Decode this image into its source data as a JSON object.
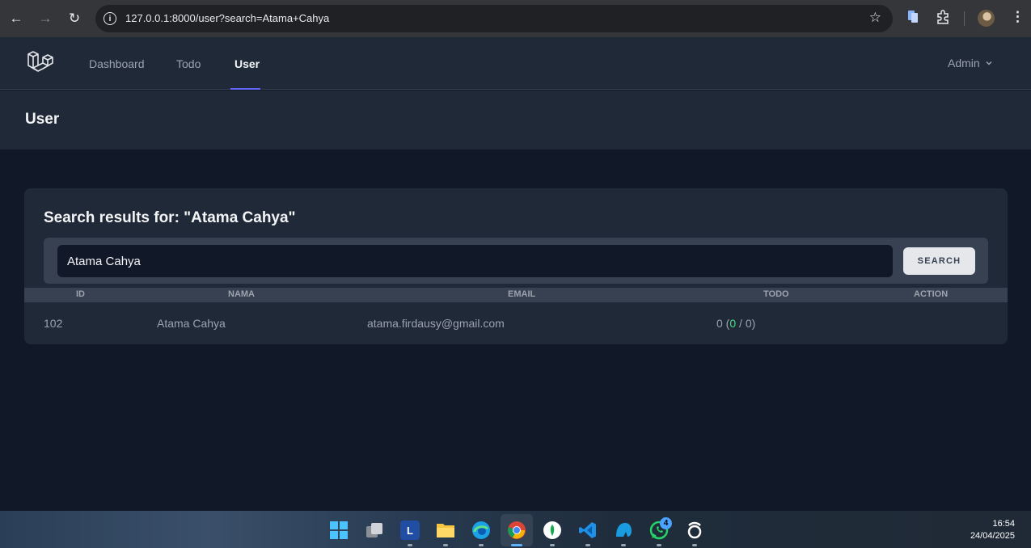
{
  "browser": {
    "url": "127.0.0.1:8000/user?search=Atama+Cahya"
  },
  "nav": {
    "links": [
      {
        "label": "Dashboard"
      },
      {
        "label": "Todo"
      },
      {
        "label": "User"
      }
    ],
    "active": "User",
    "user_menu": "Admin"
  },
  "page": {
    "title": "User"
  },
  "search": {
    "heading": "Search results for: \"Atama Cahya\"",
    "value": "Atama Cahya",
    "button_label": "SEARCH"
  },
  "table": {
    "headers": [
      "ID",
      "NAMA",
      "EMAIL",
      "TODO",
      "ACTION"
    ],
    "rows": [
      {
        "id": "102",
        "nama": "Atama Cahya",
        "email": "atama.firdausy@gmail.com",
        "todo_total": "0",
        "todo_done": "0",
        "todo_pending": "0"
      }
    ]
  },
  "taskbar": {
    "apps": [
      "start-icon",
      "task-view-icon",
      "l-app-icon",
      "file-explorer-icon",
      "edge-icon",
      "chrome-icon",
      "mongodb-compass-icon",
      "vscode-icon",
      "mysql-workbench-icon",
      "whatsapp-icon",
      "threads-icon"
    ],
    "whatsapp_badge": "4",
    "time": "16:54",
    "date": "24/04/2025"
  },
  "colors": {
    "accent": "#6366f1",
    "background": "#111827",
    "panel": "#1f2937",
    "success": "#4ade80"
  }
}
